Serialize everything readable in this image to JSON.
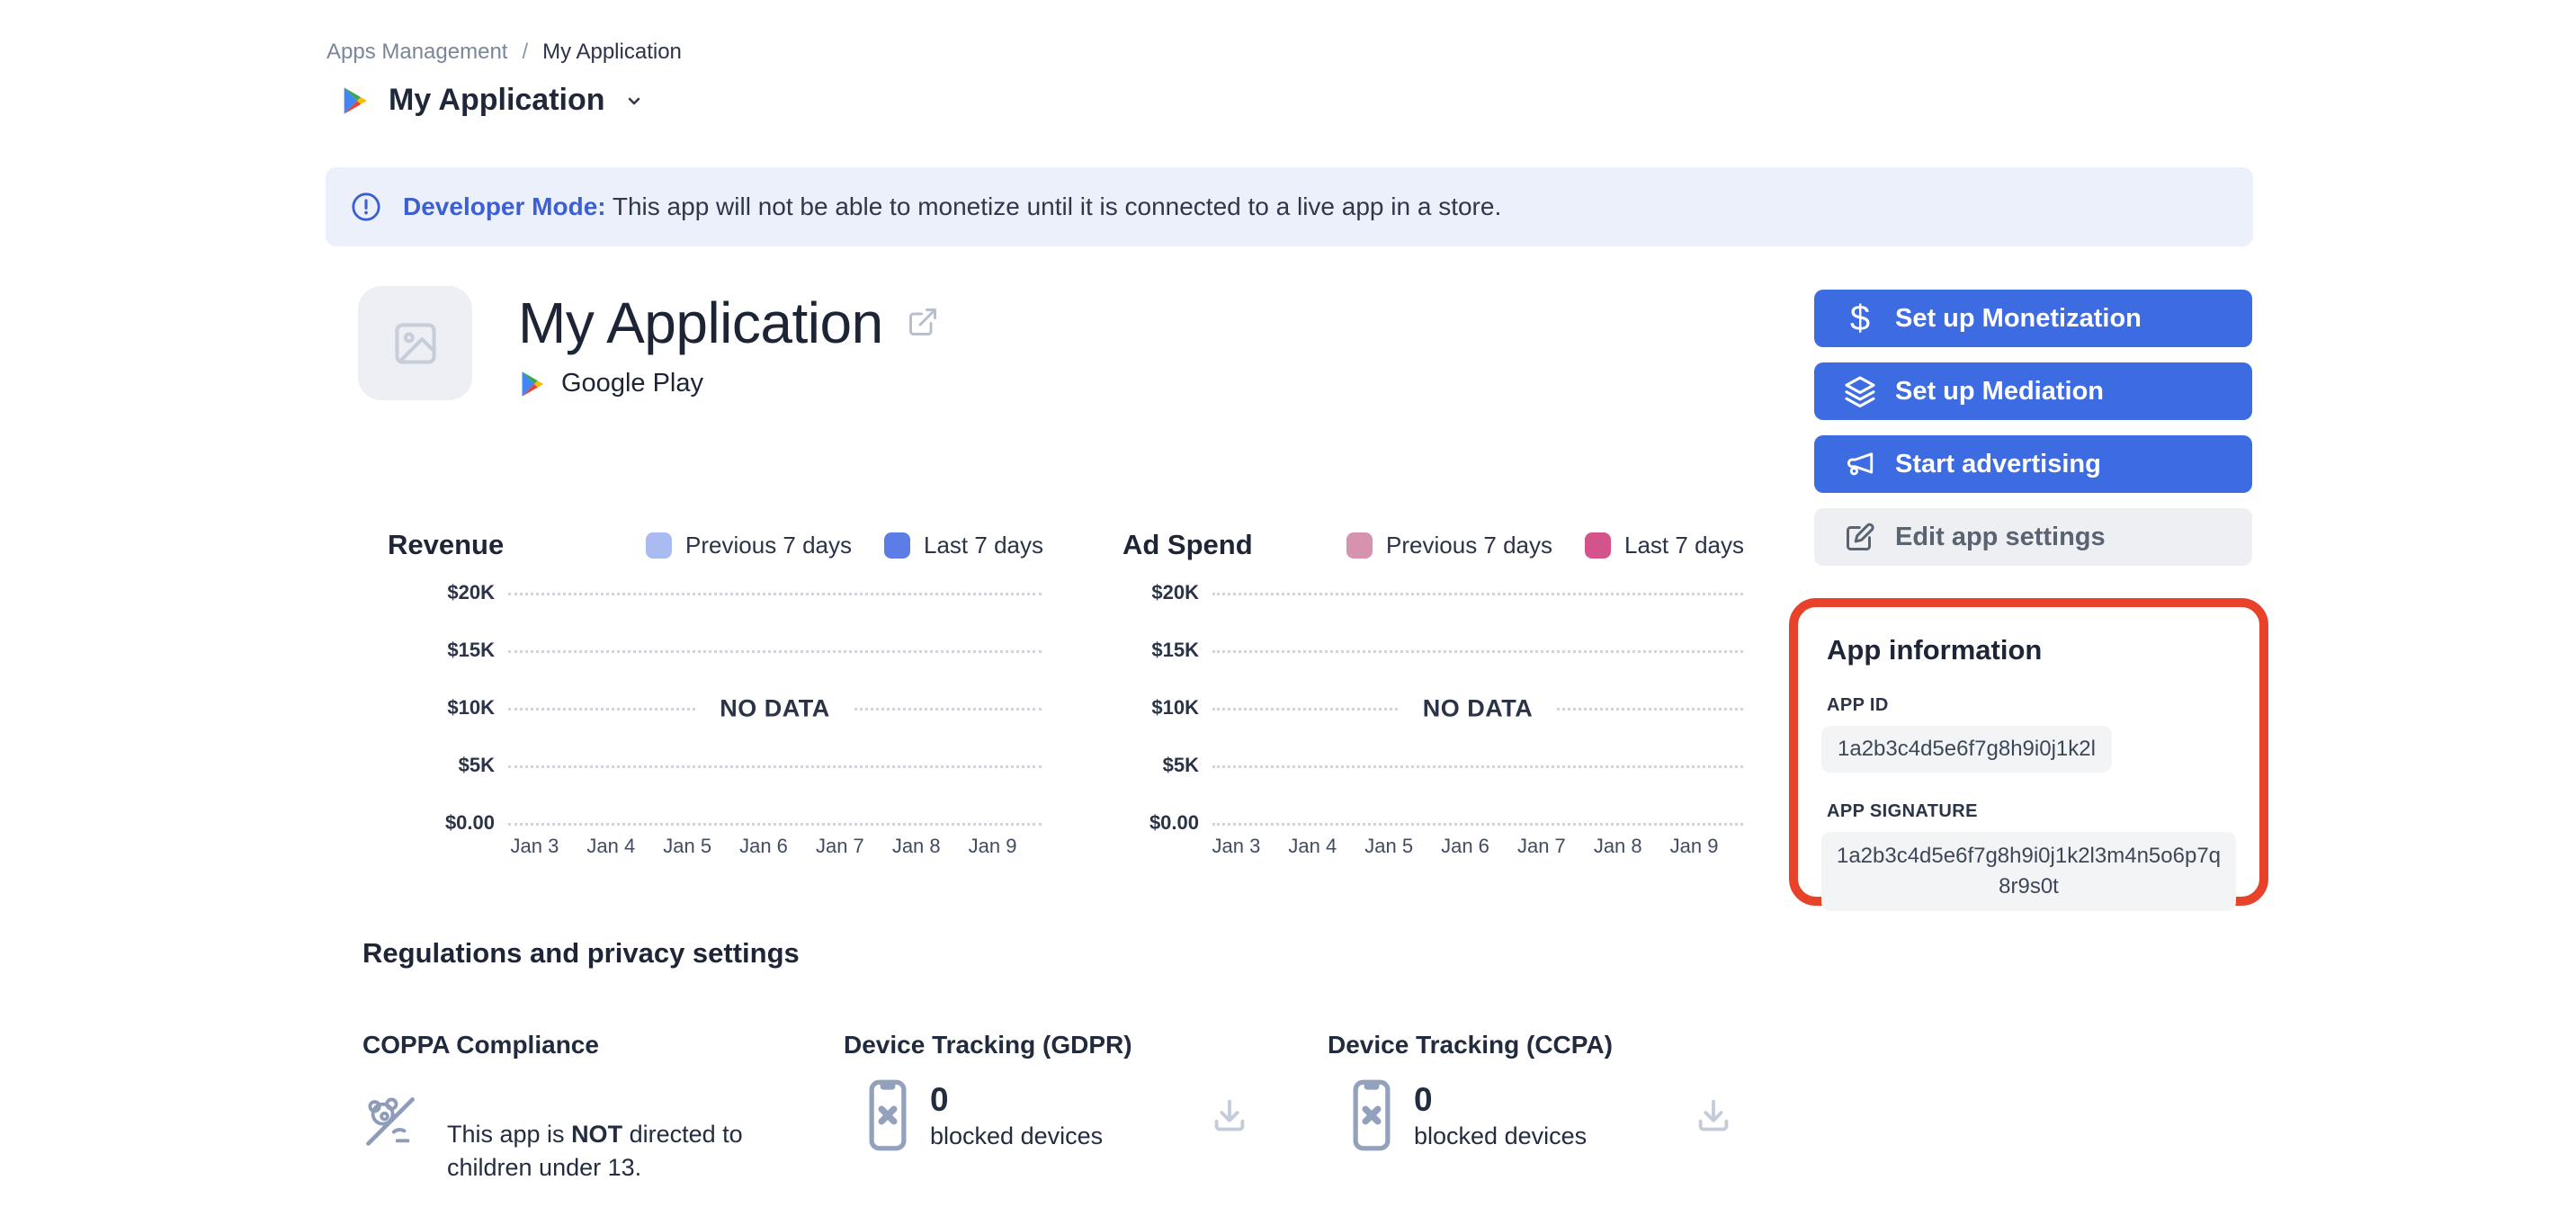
{
  "breadcrumb": {
    "parent": "Apps Management",
    "separator": "/",
    "current": "My Application"
  },
  "page": {
    "title": "My Application"
  },
  "banner": {
    "label": "Developer Mode:",
    "message": " This app will not be able to monetize until it is connected to a live app in a store."
  },
  "hero": {
    "title": "My Application",
    "platform": "Google Play"
  },
  "actions": [
    {
      "label": "Set up Monetization",
      "style": "primary",
      "icon": "dollar-icon"
    },
    {
      "label": "Set up Mediation",
      "style": "primary",
      "icon": "layers-icon"
    },
    {
      "label": "Start advertising",
      "style": "primary",
      "icon": "megaphone-icon"
    },
    {
      "label": "Edit app settings",
      "style": "secondary",
      "icon": "edit-icon"
    }
  ],
  "charts": [
    {
      "title": "Revenue",
      "legend": [
        {
          "label": "Previous 7 days",
          "color": "#a9bbf0"
        },
        {
          "label": "Last 7 days",
          "color": "#5d7de6"
        }
      ],
      "y_ticks": [
        "$20K",
        "$15K",
        "$10K",
        "$5K",
        "$0.00"
      ],
      "x_ticks": [
        "Jan 3",
        "Jan 4",
        "Jan 5",
        "Jan 6",
        "Jan 7",
        "Jan 8",
        "Jan 9"
      ],
      "empty_label": "NO DATA"
    },
    {
      "title": "Ad Spend",
      "legend": [
        {
          "label": "Previous 7 days",
          "color": "#d693ad"
        },
        {
          "label": "Last 7 days",
          "color": "#d4538a"
        }
      ],
      "y_ticks": [
        "$20K",
        "$15K",
        "$10K",
        "$5K",
        "$0.00"
      ],
      "x_ticks": [
        "Jan 3",
        "Jan 4",
        "Jan 5",
        "Jan 6",
        "Jan 7",
        "Jan 8",
        "Jan 9"
      ],
      "empty_label": "NO DATA"
    }
  ],
  "chart_data": [
    {
      "type": "line",
      "title": "Revenue",
      "x": [
        "Jan 3",
        "Jan 4",
        "Jan 5",
        "Jan 6",
        "Jan 7",
        "Jan 8",
        "Jan 9"
      ],
      "series": [
        {
          "name": "Previous 7 days",
          "values": []
        },
        {
          "name": "Last 7 days",
          "values": []
        }
      ],
      "ylim": [
        0,
        20000
      ],
      "y_tick_labels": [
        "$0.00",
        "$5K",
        "$10K",
        "$15K",
        "$20K"
      ],
      "grid": "horizontal-dotted",
      "legend_position": "top-right",
      "no_data": true
    },
    {
      "type": "line",
      "title": "Ad Spend",
      "x": [
        "Jan 3",
        "Jan 4",
        "Jan 5",
        "Jan 6",
        "Jan 7",
        "Jan 8",
        "Jan 9"
      ],
      "series": [
        {
          "name": "Previous 7 days",
          "values": []
        },
        {
          "name": "Last 7 days",
          "values": []
        }
      ],
      "ylim": [
        0,
        20000
      ],
      "y_tick_labels": [
        "$0.00",
        "$5K",
        "$10K",
        "$15K",
        "$20K"
      ],
      "grid": "horizontal-dotted",
      "legend_position": "top-right",
      "no_data": true
    }
  ],
  "app_info": {
    "title": "App information",
    "app_id_label": "APP ID",
    "app_id": "1a2b3c4d5e6f7g8h9i0j1k2l",
    "app_signature_label": "APP SIGNATURE",
    "app_signature": "1a2b3c4d5e6f7g8h9i0j1k2l3m4n5o6p7q8r9s0t"
  },
  "regulations": {
    "title": "Regulations and privacy settings",
    "coppa": {
      "title": "COPPA Compliance",
      "text_before": "This app is ",
      "text_bold": "NOT",
      "text_after": " directed to children under 13."
    },
    "gdpr": {
      "title": "Device Tracking (GDPR)",
      "count": "0",
      "label": "blocked devices"
    },
    "ccpa": {
      "title": "Device Tracking (CCPA)",
      "count": "0",
      "label": "blocked devices"
    }
  },
  "colors": {
    "primary_blue": "#3d6ce2",
    "banner_bg": "#ecf0fb",
    "banner_accent": "#3c5fd3",
    "highlight_ring": "#e8422b",
    "revenue_prev": "#a9bbf0",
    "revenue_last": "#5d7de6",
    "adspend_prev": "#d693ad",
    "adspend_last": "#d4538a"
  }
}
